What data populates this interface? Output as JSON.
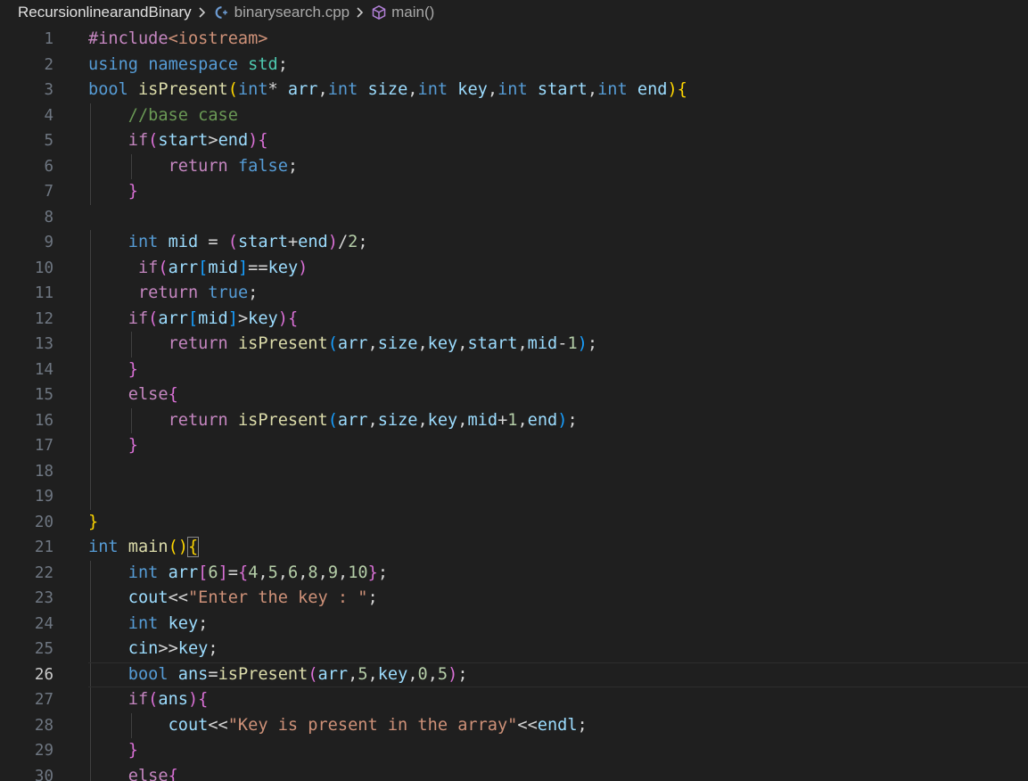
{
  "breadcrumb": {
    "folder": "RecursionlinearandBinary",
    "file": "binarysearch.cpp",
    "symbol": "main()"
  },
  "editor": {
    "active_line": 26,
    "lines": [
      {
        "n": "1",
        "text": "#include<iostream>"
      },
      {
        "n": "2",
        "text": "using namespace std;"
      },
      {
        "n": "3",
        "text": "bool isPresent(int* arr,int size,int key,int start,int end){"
      },
      {
        "n": "4",
        "text": "    //base case"
      },
      {
        "n": "5",
        "text": "    if(start>end){"
      },
      {
        "n": "6",
        "text": "        return false;"
      },
      {
        "n": "7",
        "text": "    }"
      },
      {
        "n": "8",
        "text": ""
      },
      {
        "n": "9",
        "text": "    int mid = (start+end)/2;"
      },
      {
        "n": "10",
        "text": "     if(arr[mid]==key)"
      },
      {
        "n": "11",
        "text": "     return true;"
      },
      {
        "n": "12",
        "text": "    if(arr[mid]>key){"
      },
      {
        "n": "13",
        "text": "        return isPresent(arr,size,key,start,mid-1);"
      },
      {
        "n": "14",
        "text": "    }"
      },
      {
        "n": "15",
        "text": "    else{"
      },
      {
        "n": "16",
        "text": "        return isPresent(arr,size,key,mid+1,end);"
      },
      {
        "n": "17",
        "text": "    }"
      },
      {
        "n": "18",
        "text": ""
      },
      {
        "n": "19",
        "text": ""
      },
      {
        "n": "20",
        "text": "}"
      },
      {
        "n": "21",
        "text": "int main(){"
      },
      {
        "n": "22",
        "text": "    int arr[6]={4,5,6,8,9,10};"
      },
      {
        "n": "23",
        "text": "    cout<<\"Enter the key : \";"
      },
      {
        "n": "24",
        "text": "    int key;"
      },
      {
        "n": "25",
        "text": "    cin>>key;"
      },
      {
        "n": "26",
        "text": "    bool ans=isPresent(arr,5,key,0,5);"
      },
      {
        "n": "27",
        "text": "    if(ans){"
      },
      {
        "n": "28",
        "text": "        cout<<\"Key is present in the array\"<<endl;"
      },
      {
        "n": "29",
        "text": "    }"
      },
      {
        "n": "30",
        "text": "    else{"
      }
    ]
  },
  "colors": {
    "background": "#1f1f1f",
    "keyword": "#569cd6",
    "control": "#c586c0",
    "function": "#dcdcaa",
    "variable": "#9cdcfe",
    "number": "#b5cea8",
    "string": "#ce9178",
    "comment": "#6a9955"
  },
  "icons": {
    "file": "cpp-file-icon",
    "symbol": "method-cube-icon",
    "separator": "chevron-right-icon"
  }
}
